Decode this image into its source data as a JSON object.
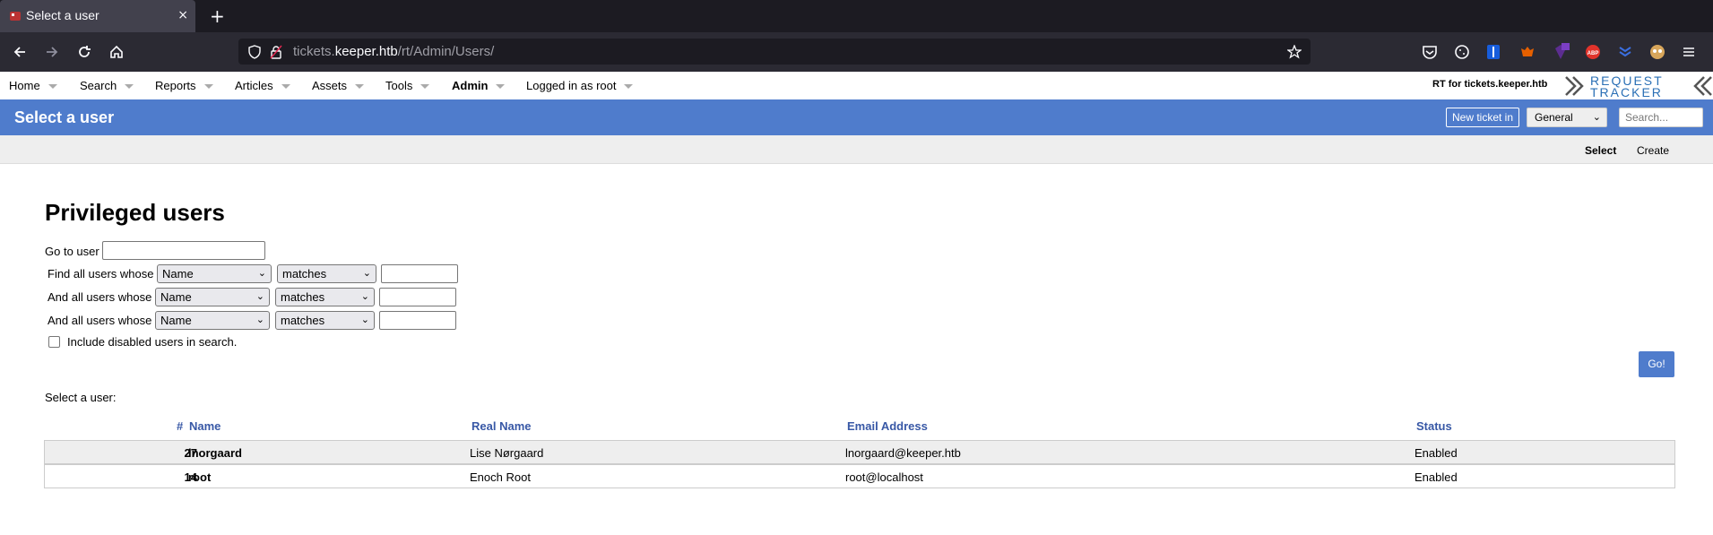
{
  "browser": {
    "tab_title": "Select a user",
    "close_icon": "×",
    "new_tab_icon": "+",
    "url_host_prefix": "tickets.",
    "url_host": "keeper.htb",
    "url_path": "/rt/Admin/Users/"
  },
  "menu": {
    "items": [
      "Home",
      "Search",
      "Reports",
      "Articles",
      "Assets",
      "Tools",
      "Admin",
      "Logged in as root"
    ],
    "rt_for": "RT for tickets.keeper.htb",
    "logo_line1": "REQUEST",
    "logo_line2": "TRACKER"
  },
  "header": {
    "title": "Select a user",
    "new_ticket": "New ticket in",
    "queue": "General",
    "search_placeholder": "Search..."
  },
  "subnav": {
    "select": "Select",
    "create": "Create"
  },
  "page": {
    "heading": "Privileged users",
    "go_to_user": "Go to user",
    "find_label": "Find all users whose",
    "and_label": "And all users whose",
    "field_option": "Name",
    "match_option": "matches",
    "include_disabled": "Include disabled users in search.",
    "go_button": "Go!",
    "select_a_user": "Select a user:"
  },
  "table": {
    "headers": {
      "num": "#",
      "name": "Name",
      "real_name": "Real Name",
      "email": "Email Address",
      "status": "Status"
    },
    "rows": [
      {
        "id": "27",
        "name": "lnorgaard",
        "real_name": "Lise Nørgaard",
        "email": "lnorgaard@keeper.htb",
        "status": "Enabled"
      },
      {
        "id": "14",
        "name": "root",
        "real_name": "Enoch Root",
        "email": "root@localhost",
        "status": "Enabled"
      }
    ]
  }
}
